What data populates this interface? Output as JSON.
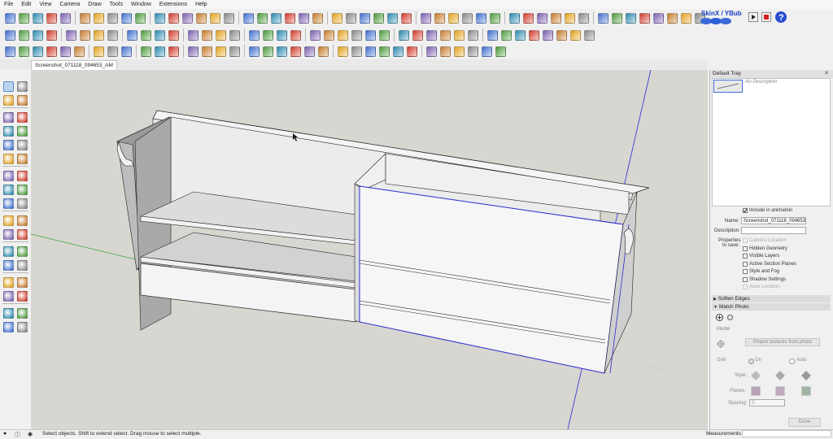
{
  "menu": [
    "File",
    "Edit",
    "View",
    "Camera",
    "Draw",
    "Tools",
    "Window",
    "Extensions",
    "Help"
  ],
  "toolbar_right": {
    "plugin_label": "SkinX / YBub"
  },
  "scene_tab": {
    "label": "Screenshot_071118_094653_AM"
  },
  "tray": {
    "title": "Default Tray",
    "scene_description_preview": "No Description",
    "include_in_animation": "Include in animation",
    "name_label": "Name:",
    "name_value": "Screenshot_071118_094653_",
    "description_label": "Description:",
    "properties_label": "Properties",
    "to_save_label": "to save:",
    "properties": [
      {
        "label": "Camera Location",
        "checked": false,
        "enabled": false
      },
      {
        "label": "Hidden Geometry",
        "checked": false,
        "enabled": true
      },
      {
        "label": "Visible Layers",
        "checked": false,
        "enabled": true
      },
      {
        "label": "Active Section Planes",
        "checked": false,
        "enabled": true
      },
      {
        "label": "Style and Fog",
        "checked": false,
        "enabled": true
      },
      {
        "label": "Shadow Settings",
        "checked": false,
        "enabled": true
      },
      {
        "label": "Axes Location",
        "checked": false,
        "enabled": false
      }
    ],
    "soften_edges": "Soften Edges",
    "match_photo": "Match Photo",
    "model_label": "Model",
    "project_button": "Project textures from photo",
    "grid_label": "Grid",
    "grid_on": "On",
    "grid_auto": "Auto",
    "style_label": "Style:",
    "planes_label": "Planes:",
    "spacing_label": "Spacing:",
    "spacing_value": "5'",
    "done_button": "Done"
  },
  "status": {
    "hint": "Select objects. Shift to extend select. Drag mouse to select multiple.",
    "measurements_label": "Measurements"
  },
  "colors": {
    "viewport_bg": "#d7d6d0",
    "selection_blue": "#2b2bd0",
    "axis_green": "#3aa63a",
    "axis_blue": "#2a2ad8",
    "axis_red": "#c83a3a"
  },
  "icons": {
    "left_tools": [
      "select-icon",
      "component-icon",
      "paint-bucket-icon",
      "eraser-icon",
      "line-icon",
      "freehand-icon",
      "rectangle-icon",
      "rotated-rectangle-icon",
      "circle-icon",
      "polygon-icon",
      "arc-icon",
      "pie-icon",
      "move-icon",
      "push-pull-icon",
      "rotate-icon",
      "follow-me-icon",
      "scale-icon",
      "offset-icon",
      "tape-measure-icon",
      "dimension-icon",
      "protractor-icon",
      "text-icon",
      "axes-icon",
      "3d-text-icon",
      "orbit-icon",
      "pan-icon",
      "zoom-icon",
      "zoom-window-icon",
      "zoom-extents-icon",
      "previous-view-icon",
      "position-camera-icon",
      "look-around-icon",
      "walk-icon",
      "section-plane-icon"
    ]
  }
}
